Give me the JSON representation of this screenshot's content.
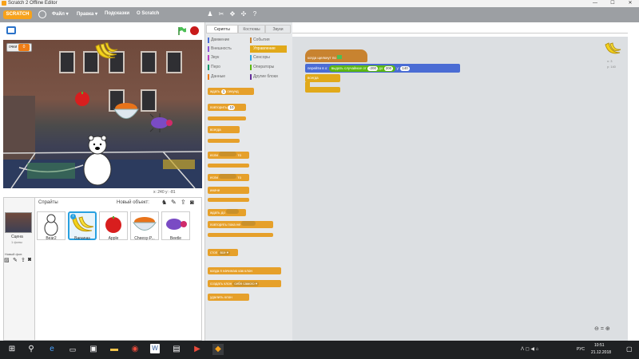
{
  "window": {
    "title": "Scratch 2 Offline Editor",
    "controls": [
      "—",
      "☐",
      "✕"
    ]
  },
  "menu": {
    "logo": "SCRATCH",
    "items": [
      "Файл ▾",
      "Правка ▾",
      "Подсказки",
      "О Scratch"
    ],
    "tool_icons": [
      "duplicate-icon",
      "delete-icon",
      "grow-icon",
      "shrink-icon",
      "help-icon"
    ]
  },
  "stage": {
    "variable_label": "очки",
    "variable_value": "0",
    "coords": "x: 240   y: -81"
  },
  "sprites_pane": {
    "title": "Спрайты",
    "new_object_label": "Новый объект:",
    "stage_label": "Сцена",
    "stage_sublabel": "1 фоны",
    "new_backdrop_label": "Новый фон:",
    "sprites": [
      {
        "name": "Bear2",
        "icon": "bear-icon"
      },
      {
        "name": "Bananas",
        "icon": "banana-icon",
        "selected": true
      },
      {
        "name": "Apple",
        "icon": "apple-icon"
      },
      {
        "name": "Cheesy-P...",
        "icon": "bowl-icon"
      },
      {
        "name": "Beetle",
        "icon": "beetle-icon"
      }
    ]
  },
  "palette": {
    "tabs": [
      "Скрипты",
      "Костюмы",
      "Звуки"
    ],
    "categories": [
      {
        "label": "Движение",
        "color": "#4a6cd4"
      },
      {
        "label": "События",
        "color": "#c88330"
      },
      {
        "label": "Внешность",
        "color": "#8a55d7"
      },
      {
        "label": "Управление",
        "color": "#e1a91a",
        "active": true
      },
      {
        "label": "Звук",
        "color": "#bb42c3"
      },
      {
        "label": "Сенсоры",
        "color": "#2ca5e2"
      },
      {
        "label": "Перо",
        "color": "#0e9a6c"
      },
      {
        "label": "Операторы",
        "color": "#5cb712"
      },
      {
        "label": "Данные",
        "color": "#ee7d16"
      },
      {
        "label": "Другие блоки",
        "color": "#632d99"
      }
    ],
    "blocks": [
      {
        "text": "ждать",
        "slot": "1",
        "suffix": "секунд"
      },
      {
        "text": "повторить",
        "slot": "10",
        "suffix": ""
      },
      {
        "text": "всегда",
        "slot": "",
        "suffix": ""
      },
      {
        "text": "если",
        "slot": "",
        "suffix": "то"
      },
      {
        "text": "если",
        "slot": "",
        "suffix": "то"
      },
      {
        "text": "иначе",
        "slot": "",
        "suffix": ""
      },
      {
        "text": "ждать до",
        "slot": "",
        "suffix": ""
      },
      {
        "text": "повторять пока не",
        "slot": "",
        "suffix": ""
      },
      {
        "text": "стоп",
        "slot": "все ▾",
        "suffix": ""
      },
      {
        "text": "когда я начинаю как клон",
        "slot": "",
        "suffix": ""
      },
      {
        "text": "создать клон",
        "slot": "себя самого ▾",
        "suffix": ""
      },
      {
        "text": "удалить клон",
        "slot": "",
        "suffix": ""
      }
    ]
  },
  "script": {
    "hat": "когда щелкнут по",
    "goto_text": "перейти в x:",
    "random_text": "выдать случайное от",
    "random_from": "-200",
    "random_to_label": "до",
    "random_to": "200",
    "y_label": "y:",
    "y_value": "140",
    "forever": "всегда",
    "sprite_info": {
      "x": "x: 3",
      "y": "y: 140"
    }
  },
  "zoom": {
    "labels": [
      "⊖",
      "=",
      "⊕"
    ]
  },
  "taskbar": {
    "start": "⊞",
    "search": "⚲",
    "apps": [
      "task-view-icon",
      "edge-icon",
      "explorer-icon",
      "store-icon",
      "files-icon",
      "chrome-icon",
      "word-icon",
      "obs-icon",
      "scratch-icon"
    ],
    "tray_lang": "РУС",
    "time": "10:51",
    "date": "21.12.2018"
  }
}
